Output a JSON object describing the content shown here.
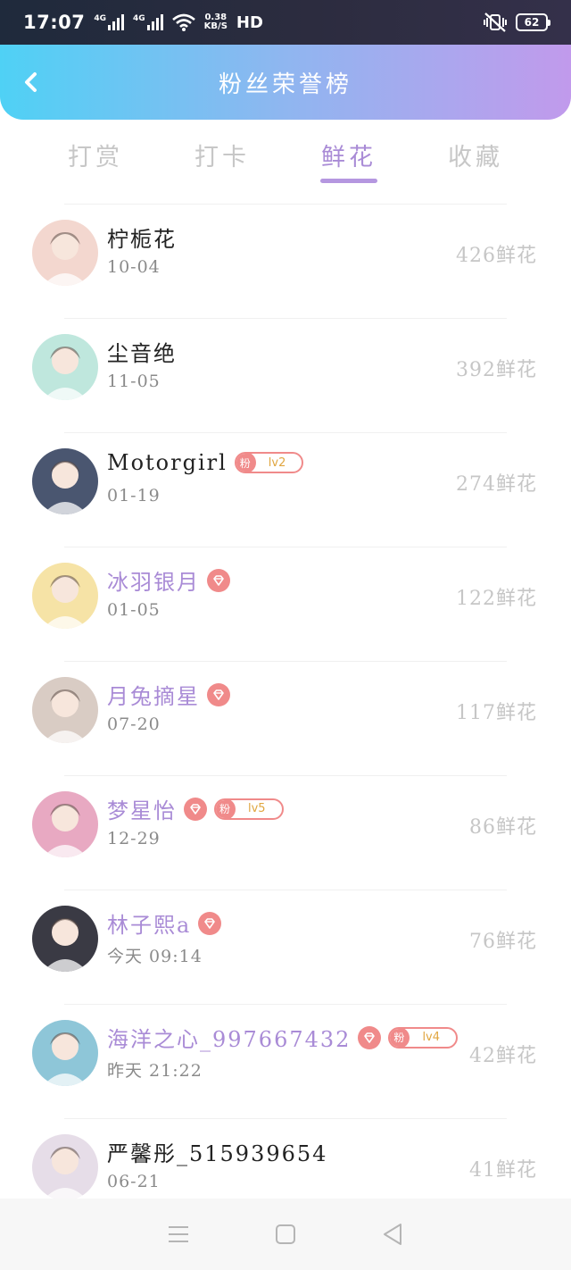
{
  "status_bar": {
    "time": "17:07",
    "network_1": "4G",
    "network_2": "4G",
    "speed_value": "0.38",
    "speed_unit": "KB/S",
    "hd": "HD",
    "battery": "62"
  },
  "header": {
    "title": "粉丝荣誉榜"
  },
  "tabs": [
    {
      "label": "打赏",
      "active": false
    },
    {
      "label": "打卡",
      "active": false
    },
    {
      "label": "鲜花",
      "active": true
    },
    {
      "label": "收藏",
      "active": false
    }
  ],
  "fans": [
    {
      "name": "柠栀花",
      "date": "10-04",
      "count": "426鲜花",
      "vip": false,
      "diamond": false,
      "fan_level": null,
      "avatar_color": "#f3d7cf"
    },
    {
      "name": "尘音绝",
      "date": "11-05",
      "count": "392鲜花",
      "vip": false,
      "diamond": false,
      "fan_level": null,
      "avatar_color": "#bfe7dd"
    },
    {
      "name": "Motorgirl",
      "date": "01-19",
      "count": "274鲜花",
      "vip": false,
      "diamond": false,
      "fan_level": "lv2",
      "avatar_color": "#4a5670"
    },
    {
      "name": "冰羽银月",
      "date": "01-05",
      "count": "122鲜花",
      "vip": true,
      "diamond": true,
      "fan_level": null,
      "avatar_color": "#f6e3a6"
    },
    {
      "name": "月兔摘星",
      "date": "07-20",
      "count": "117鲜花",
      "vip": true,
      "diamond": true,
      "fan_level": null,
      "avatar_color": "#d9ccc4"
    },
    {
      "name": "梦星怡",
      "date": "12-29",
      "count": "86鲜花",
      "vip": true,
      "diamond": true,
      "fan_level": "lv5",
      "avatar_color": "#e8a9c2"
    },
    {
      "name": "林子熙a",
      "date": "今天 09:14",
      "count": "76鲜花",
      "vip": true,
      "diamond": true,
      "fan_level": null,
      "avatar_color": "#3a3a44"
    },
    {
      "name": "海洋之心_997667432",
      "date": "昨天 21:22",
      "count": "42鲜花",
      "vip": true,
      "diamond": true,
      "fan_level": "lv4",
      "avatar_color": "#8ec6d8"
    },
    {
      "name": "严馨彤_515939654",
      "date": "06-21",
      "count": "41鲜花",
      "vip": false,
      "diamond": false,
      "fan_level": null,
      "avatar_color": "#e6dde8"
    }
  ],
  "fan_tag_label": "粉",
  "colors": {
    "accent": "#a98bd6",
    "badge": "#f08a8a",
    "header_start": "#4fd1f5",
    "header_end": "#c19aec"
  }
}
